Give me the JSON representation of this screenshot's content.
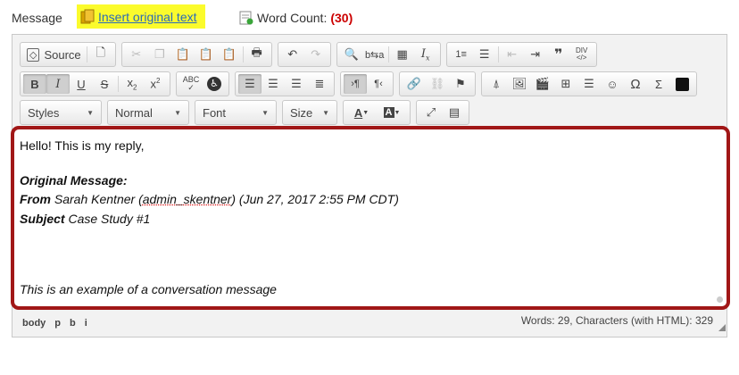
{
  "header": {
    "message_label": "Message",
    "insert_label": "Insert original text",
    "word_count_label": "Word Count:",
    "word_count_value": "(30)",
    "highlight_color": "#fbfb2c"
  },
  "toolbar": {
    "source_label": "Source",
    "styles_label": "Styles",
    "format_label": "Normal",
    "font_label": "Font",
    "size_label": "Size"
  },
  "content": {
    "line1": "Hello! This is my reply,",
    "orig_heading": "Original Message:",
    "from_label": "From",
    "from_name": "Sarah Kentner (",
    "from_user": "admin_skentner",
    "from_rest": ") (Jun 27, 2017 2:55 PM CDT)",
    "subject_label": "Subject",
    "subject_value": "Case Study #1",
    "body_text": "This is an example of a conversation message",
    "frame_color": "#a11717"
  },
  "statusbar": {
    "path": [
      "body",
      "p",
      "b",
      "i"
    ],
    "counts": "Words: 29, Characters (with HTML): 329"
  }
}
